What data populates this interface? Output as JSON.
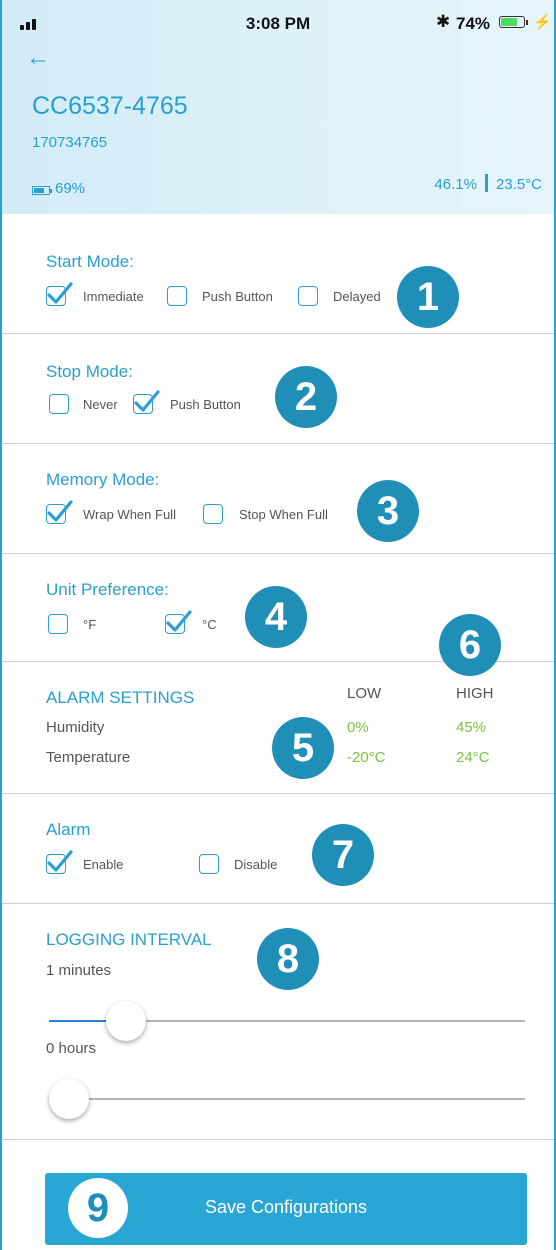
{
  "status_bar": {
    "time": "3:08 PM",
    "bluetooth": "✱",
    "battery": "74%",
    "charging": "⚡"
  },
  "nav": {
    "back_icon": "←"
  },
  "device": {
    "name": "CC6537-4765",
    "serial": "170734765",
    "battery": "69%",
    "humidity": "46.1%",
    "temperature": "23.5°C"
  },
  "start_mode": {
    "title": "Start Mode:",
    "options": [
      {
        "label": "Immediate",
        "checked": true
      },
      {
        "label": "Push Button",
        "checked": false
      },
      {
        "label": "Delayed",
        "checked": false
      }
    ]
  },
  "stop_mode": {
    "title": "Stop Mode:",
    "options": [
      {
        "label": "Never",
        "checked": false
      },
      {
        "label": "Push Button",
        "checked": true
      }
    ]
  },
  "memory_mode": {
    "title": "Memory Mode:",
    "options": [
      {
        "label": "Wrap When Full",
        "checked": true
      },
      {
        "label": "Stop When Full",
        "checked": false
      }
    ]
  },
  "unit_preference": {
    "title": "Unit Preference:",
    "options": [
      {
        "label": "°F",
        "checked": false
      },
      {
        "label": "°C",
        "checked": true
      }
    ]
  },
  "alarm_settings": {
    "title": "ALARM SETTINGS",
    "low_header": "LOW",
    "high_header": "HIGH",
    "rows": [
      {
        "label": "Humidity",
        "low": "0%",
        "high": "45%"
      },
      {
        "label": "Temperature",
        "low": "-20°C",
        "high": "24°C"
      }
    ]
  },
  "alarm": {
    "title": "Alarm",
    "options": [
      {
        "label": "Enable",
        "checked": true
      },
      {
        "label": "Disable",
        "checked": false
      }
    ]
  },
  "logging_interval": {
    "title": "LOGGING INTERVAL",
    "minutes_label": "1 minutes",
    "minutes_fraction": 0.12,
    "hours_label": "0 hours",
    "hours_fraction": 0.0
  },
  "save_button": {
    "label": "Save Configurations"
  },
  "annotations": [
    "1",
    "2",
    "3",
    "4",
    "5",
    "6",
    "7",
    "8",
    "9"
  ],
  "colors": {
    "accent": "#2a9fd0",
    "badge": "#1f8fb8",
    "alarm_value": "#7cc242",
    "button": "#2aa6d4"
  }
}
